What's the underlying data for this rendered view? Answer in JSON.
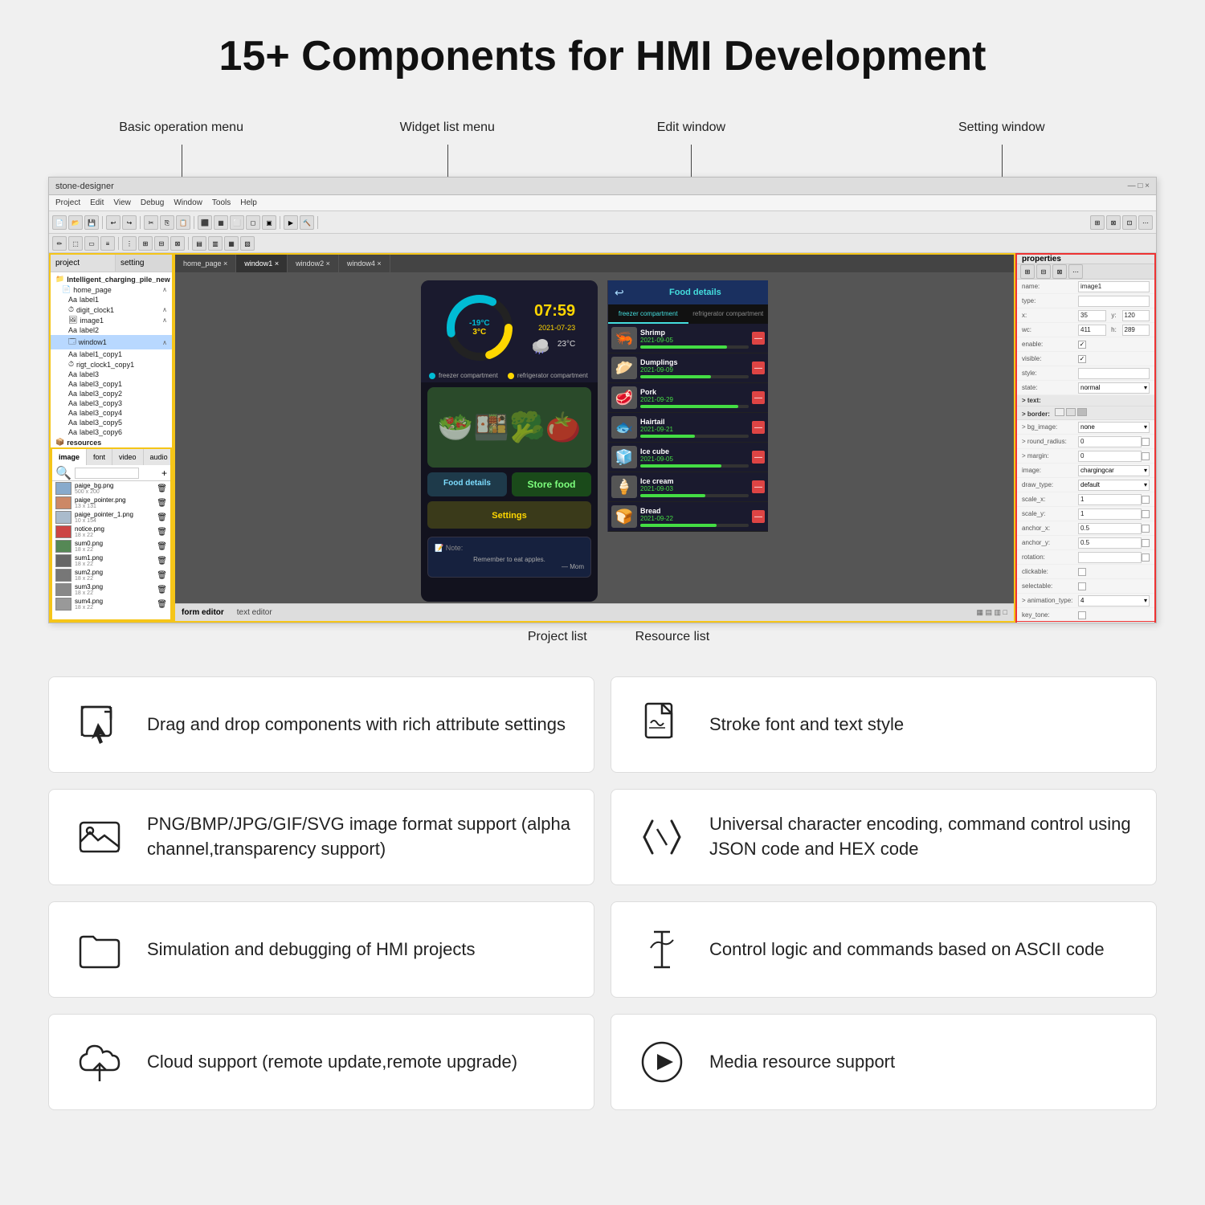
{
  "page": {
    "title": "15+ Components for HMI Development",
    "annotations": {
      "basic_op": "Basic operation menu",
      "widget_list": "Widget list menu",
      "edit_window": "Edit window",
      "setting_window": "Setting window",
      "project_list": "Project list",
      "resource_list": "Resource list"
    },
    "ide": {
      "title": "stone-designer",
      "menu_items": [
        "Project",
        "Edit",
        "View",
        "Debug",
        "Window",
        "Tools",
        "Help"
      ],
      "tabs": [
        "home_page ×",
        "window1 ×",
        "window2 ×",
        "window4 ×"
      ],
      "bottom_tabs": [
        "form editor",
        "text editor"
      ]
    },
    "phone": {
      "time": "07:59",
      "date": "2021-07-23",
      "temp_freezer": "-19°C",
      "temp_fridge": "3°C",
      "weather_temp": "23°C",
      "food_header": "Food details",
      "store_food": "Store food",
      "food_details": "Food details",
      "settings": "Settings",
      "note_title": "📝 Note:",
      "note_content": "Remember to eat apples.\n— Mom",
      "legend": {
        "freezer": "freezer compartment",
        "refrigerator": "refrigerator compartment"
      },
      "compartments": [
        "freezer compartment",
        "refrigerator compartment"
      ],
      "food_items": [
        {
          "name": "Shrimp",
          "date": "2021-09-05",
          "bar": 80,
          "emoji": "🦐"
        },
        {
          "name": "Dumplings",
          "date": "2021-09-09",
          "bar": 65,
          "emoji": "🥟"
        },
        {
          "name": "Pork",
          "date": "2021-09-29",
          "bar": 90,
          "emoji": "🥩"
        },
        {
          "name": "Hairtail",
          "date": "2021-09-21",
          "bar": 50,
          "emoji": "🐟"
        },
        {
          "name": "Ice cube",
          "date": "2021-09-05",
          "bar": 75,
          "emoji": "🧊"
        },
        {
          "name": "Ice cream",
          "date": "2021-09-03",
          "bar": 60,
          "emoji": "🍦"
        },
        {
          "name": "Bread",
          "date": "2021-09-22",
          "bar": 70,
          "emoji": "🍞"
        }
      ]
    },
    "properties": {
      "name": "image1",
      "type": "",
      "x": "35",
      "y": "120",
      "w": "411",
      "h": "289",
      "enable": true,
      "visible": true,
      "style": "",
      "state": "normal",
      "image": "chargingcar",
      "draw_type": "default",
      "scale_x": "1",
      "scale_y": "1",
      "anchor_x": "0.5",
      "anchor_y": "0.5",
      "rotation": "",
      "clickable": false,
      "selectable": false,
      "animation_type": "4",
      "key_tone": false
    },
    "project_items": [
      "Intelligent_charging_pile_new",
      "home_page",
      "label1",
      "digit_clock1",
      "image1",
      "label2",
      "window1",
      "label1_copy1",
      "rigt_clock1_copy1",
      "label3",
      "label3_copy1",
      "label3_copy2",
      "label3_copy3",
      "label3_copy4",
      "label3_copy5",
      "label3_copy6"
    ],
    "resource_items": [
      {
        "name": "paige_bg.png",
        "size": "500 x 200"
      },
      {
        "name": "paige_pointer.png",
        "size": "13 x 131"
      },
      {
        "name": "paige_pointer_1.png",
        "size": "10 x 154"
      },
      {
        "name": "notice.png",
        "size": "18 x 22"
      },
      {
        "name": "sum0.png",
        "size": "18 x 22"
      },
      {
        "name": "sum1.png",
        "size": "18 x 22"
      },
      {
        "name": "sum2.png",
        "size": "18 x 22"
      },
      {
        "name": "sum3.png",
        "size": "18 x 22"
      },
      {
        "name": "sum4.png",
        "size": "18 x 22"
      }
    ],
    "features": [
      {
        "id": "drag-drop",
        "icon": "cursor-arrow",
        "text": "Drag and drop components with rich attribute settings"
      },
      {
        "id": "stroke-font",
        "icon": "font-file",
        "text": "Stroke font and text style"
      },
      {
        "id": "image-format",
        "icon": "image-landscape",
        "text": "PNG/BMP/JPG/GIF/SVG image format support (alpha channel,transparency support)"
      },
      {
        "id": "json-control",
        "icon": "code-brackets",
        "text": "Universal character encoding, command control using JSON code and HEX code"
      },
      {
        "id": "simulation",
        "icon": "folder",
        "text": "Simulation and debugging of HMI projects"
      },
      {
        "id": "ascii",
        "icon": "text-cursor",
        "text": "Control logic and commands based on ASCII code"
      },
      {
        "id": "cloud",
        "icon": "cloud-upload",
        "text": "Cloud support (remote update,remote upgrade)"
      },
      {
        "id": "media",
        "icon": "play-circle",
        "text": "Media resource support"
      }
    ]
  }
}
